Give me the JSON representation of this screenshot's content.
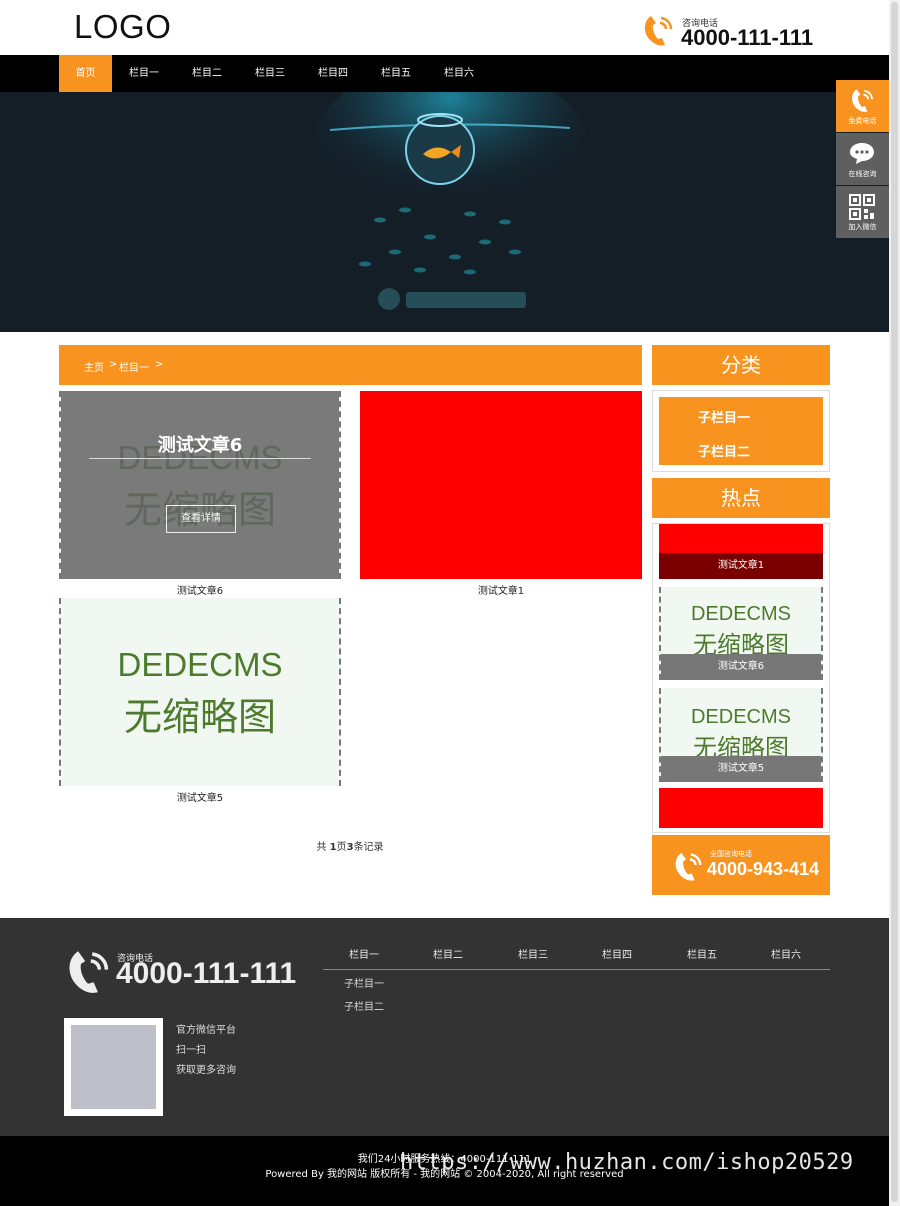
{
  "header": {
    "logo": "LOGO",
    "phone_caption": "咨询电话",
    "phone_number": "4000-111-111",
    "accent": "#f7931e"
  },
  "nav": {
    "items": [
      "首页",
      "栏目一",
      "栏目二",
      "栏目三",
      "栏目四",
      "栏目五",
      "栏目六"
    ],
    "active": 0
  },
  "breadcrumb": {
    "home": "主页",
    "sep": ">",
    "current": "栏目一",
    "tail": ">"
  },
  "articles": [
    {
      "title": "测试文章6",
      "thumb": "nothumb",
      "hover": true
    },
    {
      "title": "测试文章1",
      "thumb": "red"
    },
    {
      "title": "测试文章5",
      "thumb": "nothumb"
    }
  ],
  "nothumb": {
    "line1": "DEDECMS",
    "line2": "无缩略图"
  },
  "overlay": {
    "title": "测试文章6",
    "button": "查看详情"
  },
  "pager": {
    "prefix": "共",
    "pages": "1",
    "mid": "页",
    "count": "3",
    "suffix": "条记录"
  },
  "sidebar": {
    "category_title": "分类",
    "categories": [
      "子栏目一",
      "子栏目二"
    ],
    "hot_title": "热点",
    "hot": [
      "测试文章1",
      "测试文章6",
      "测试文章5"
    ],
    "phone_caption": "全国咨询电话",
    "phone_number": "4000-943-414"
  },
  "float": {
    "items": [
      "免费电话",
      "在线咨询",
      "加入微信"
    ]
  },
  "footer": {
    "phone_caption": "咨询电话",
    "phone_number": "4000-111-111",
    "nav": [
      "栏目一",
      "栏目二",
      "栏目三",
      "栏目四",
      "栏目五",
      "栏目六"
    ],
    "sub": [
      "子栏目一",
      "子栏目二"
    ],
    "wechat": [
      "官方微信平台",
      "扫一扫",
      "获取更多咨询"
    ],
    "hotline": "我们24小时服务热线：4000-111-111",
    "copyright": "Powered By 我的网站 版权所有 - 我的网站 © 2004-2020, All right reserved",
    "watermark": "https://www.huzhan.com/ishop20529"
  }
}
